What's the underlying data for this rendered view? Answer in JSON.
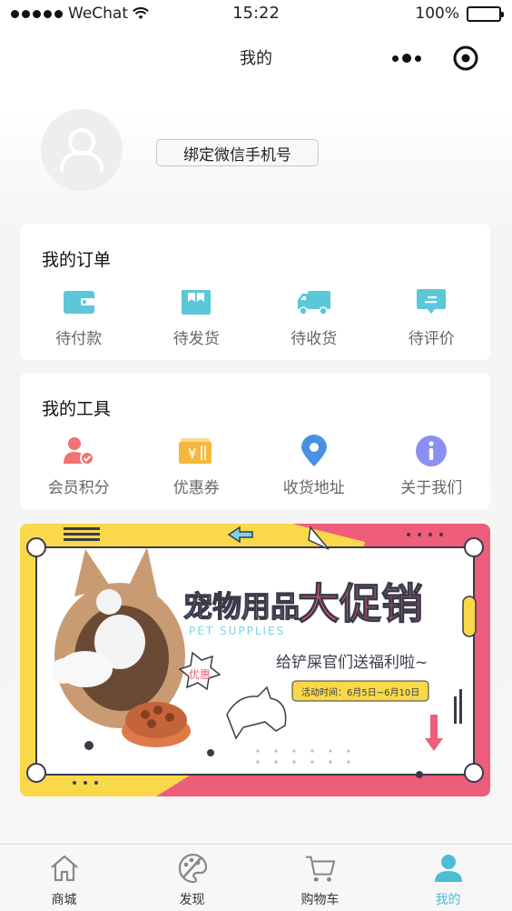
{
  "status_bar": {
    "carrier": "WeChat",
    "time": "15:22",
    "battery": "100%",
    "battery_level": 1.0
  },
  "nav": {
    "title": "我的"
  },
  "profile": {
    "bind_phone_label": "绑定微信手机号"
  },
  "orders": {
    "title": "我的订单",
    "items": [
      {
        "label": "待付款",
        "icon": "wallet-icon"
      },
      {
        "label": "待发货",
        "icon": "package-icon"
      },
      {
        "label": "待收货",
        "icon": "truck-icon"
      },
      {
        "label": "待评价",
        "icon": "comment-icon"
      }
    ]
  },
  "tools": {
    "title": "我的工具",
    "items": [
      {
        "label": "会员积分",
        "icon": "member-points-icon"
      },
      {
        "label": "优惠券",
        "icon": "coupon-icon"
      },
      {
        "label": "收货地址",
        "icon": "location-pin-icon"
      },
      {
        "label": "关于我们",
        "icon": "info-icon"
      }
    ]
  },
  "banner": {
    "headline_1": "宠物用品",
    "headline_2": "大促销",
    "english": "PET SUPPLIES",
    "subtitle": "给铲屎官们送福利啦~",
    "date_line": "活动时间：6月5日~6月10日",
    "tag": "优惠"
  },
  "tabs": [
    {
      "label": "商城",
      "icon": "home-icon"
    },
    {
      "label": "发现",
      "icon": "palette-icon"
    },
    {
      "label": "购物车",
      "icon": "cart-icon"
    },
    {
      "label": "我的",
      "icon": "user-icon",
      "active": true
    }
  ],
  "colors": {
    "accent": "#4bbdd6",
    "teal_icon": "#5cc7d9",
    "coral": "#f27173",
    "gold": "#f5b83c",
    "blue": "#4a90e2",
    "purple": "#8c8ff2",
    "banner_yellow": "#f9d94a",
    "banner_pink": "#ee5d79"
  }
}
